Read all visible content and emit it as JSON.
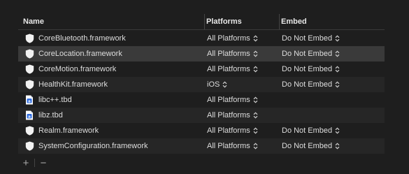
{
  "header": {
    "name": "Name",
    "platforms": "Platforms",
    "embed": "Embed"
  },
  "rows": [
    {
      "name": "CoreBluetooth.framework",
      "icon": "framework-shield-icon",
      "platform": "All Platforms",
      "embed": "Do Not Embed"
    },
    {
      "name": "CoreLocation.framework",
      "icon": "framework-shield-icon",
      "platform": "All Platforms",
      "embed": "Do Not Embed",
      "selected": true
    },
    {
      "name": "CoreMotion.framework",
      "icon": "framework-shield-icon",
      "platform": "All Platforms",
      "embed": "Do Not Embed"
    },
    {
      "name": "HealthKit.framework",
      "icon": "framework-shield-icon",
      "platform": "iOS",
      "embed": "Do Not Embed"
    },
    {
      "name": "libc++.tbd",
      "icon": "tbd-file-icon",
      "platform": "All Platforms",
      "embed": ""
    },
    {
      "name": "libz.tbd",
      "icon": "tbd-file-icon",
      "platform": "All Platforms",
      "embed": ""
    },
    {
      "name": "Realm.framework",
      "icon": "framework-shield-icon",
      "platform": "All Platforms",
      "embed": "Do Not Embed"
    },
    {
      "name": "SystemConfiguration.framework",
      "icon": "framework-shield-icon",
      "platform": "All Platforms",
      "embed": "Do Not Embed"
    }
  ],
  "footer": {
    "add": "+",
    "remove": "−"
  }
}
